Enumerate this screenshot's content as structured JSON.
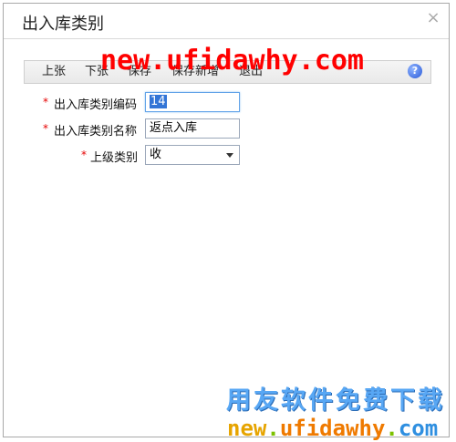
{
  "dialog": {
    "title": "出入库类别",
    "close_icon": "close-icon"
  },
  "toolbar": {
    "buttons": [
      "上张",
      "下张",
      "保存",
      "保存新增",
      "退出"
    ],
    "help_icon": "help-icon",
    "help_symbol": "?"
  },
  "form": {
    "required_mark": "*",
    "code": {
      "label": "出入库类别编码",
      "value": "14"
    },
    "name": {
      "label": "出入库类别名称",
      "value": "返点入库"
    },
    "parent": {
      "label": "上级类别",
      "value": "收"
    }
  },
  "watermarks": {
    "top_url": "new.ufidawhy.com",
    "bottom_cn": "用友软件免费下载",
    "bottom_url": {
      "part1": "new",
      "dot1": ".",
      "part2": "ufidawhy",
      "dot2": ".",
      "part3": "com"
    },
    "colors": {
      "top": "#ff0000",
      "bottom_cn": "#58a7f4",
      "part1": "#e6a400",
      "part2": "#ef7a00",
      "part3": "#2f8fe0",
      "dot": "#7cc100"
    }
  }
}
